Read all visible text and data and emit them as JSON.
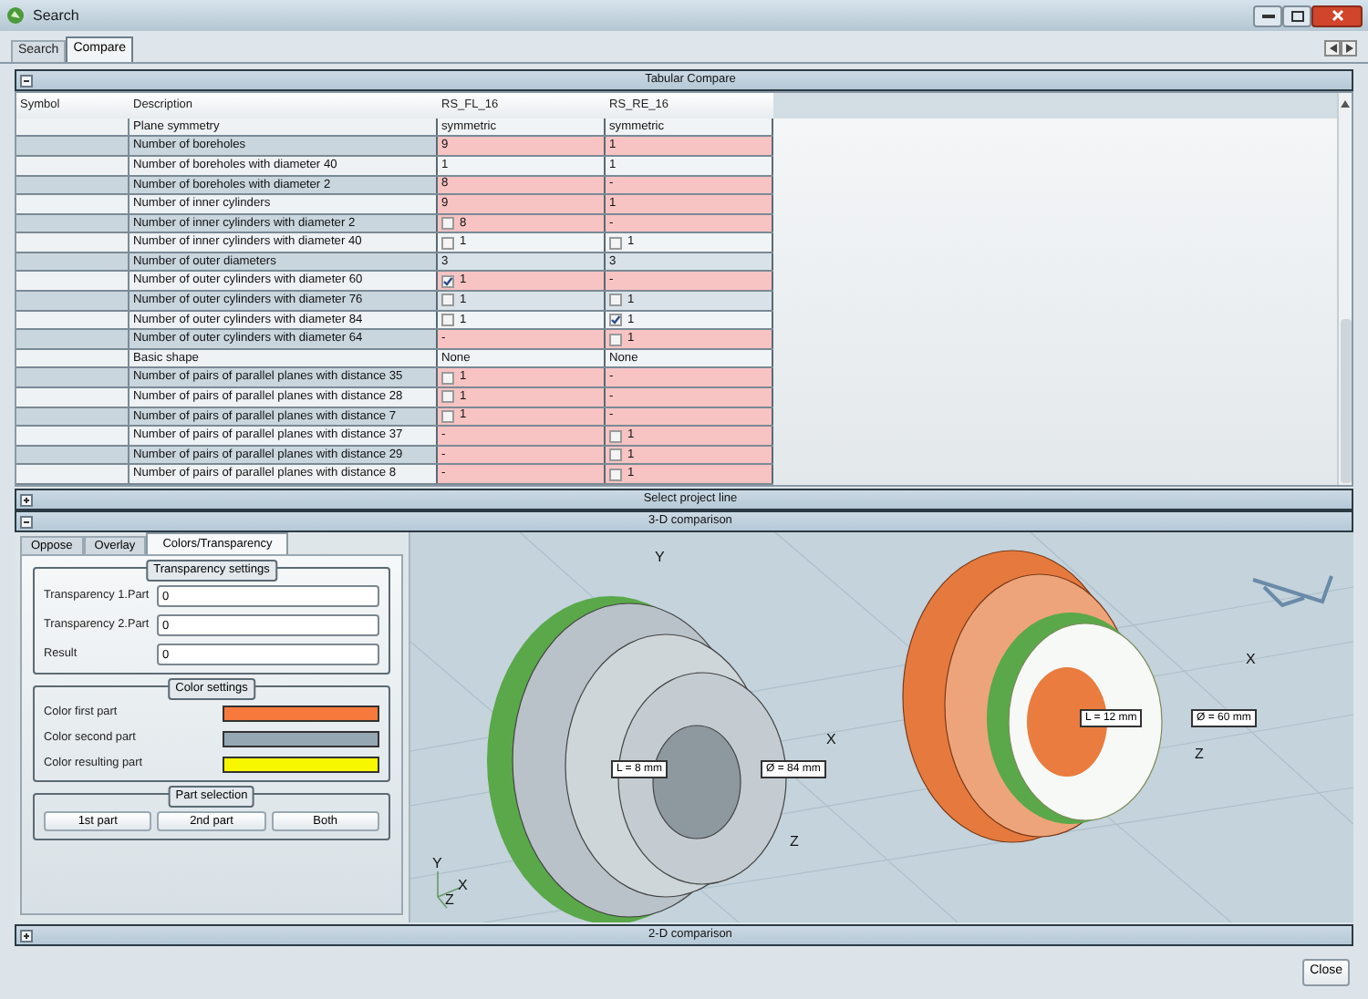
{
  "window": {
    "title": "Search"
  },
  "tabs": [
    {
      "label": "Search",
      "selected": false
    },
    {
      "label": "Compare",
      "selected": true
    }
  ],
  "tabular_compare": {
    "title": "Tabular Compare",
    "expanded": true
  },
  "table": {
    "columns": [
      "Symbol",
      "Description",
      "RS_FL_16",
      "RS_RE_16"
    ],
    "rows": [
      {
        "description": "Plane symmetry",
        "differs": false,
        "values": [
          {
            "kind": "text",
            "text": "symmetric"
          },
          {
            "kind": "text",
            "text": "symmetric"
          }
        ]
      },
      {
        "description": "Number of boreholes",
        "differs": true,
        "values": [
          {
            "kind": "text",
            "text": "9"
          },
          {
            "kind": "text",
            "text": "1"
          }
        ]
      },
      {
        "description": "Number of boreholes with diameter 40",
        "differs": false,
        "values": [
          {
            "kind": "text",
            "text": "1"
          },
          {
            "kind": "text",
            "text": "1"
          }
        ]
      },
      {
        "description": "Number of boreholes with diameter 2",
        "differs": true,
        "values": [
          {
            "kind": "text",
            "text": "8"
          },
          {
            "kind": "text",
            "text": "-"
          }
        ]
      },
      {
        "description": "Number of inner cylinders",
        "differs": true,
        "values": [
          {
            "kind": "text",
            "text": "9"
          },
          {
            "kind": "text",
            "text": "1"
          }
        ]
      },
      {
        "description": "Number of inner cylinders with diameter 2",
        "differs": true,
        "values": [
          {
            "kind": "check",
            "checked": false,
            "text": "8"
          },
          {
            "kind": "text",
            "text": "-"
          }
        ]
      },
      {
        "description": "Number of inner cylinders with diameter 40",
        "differs": false,
        "values": [
          {
            "kind": "check",
            "checked": false,
            "text": "1"
          },
          {
            "kind": "check",
            "checked": false,
            "text": "1"
          }
        ]
      },
      {
        "description": "Number of outer diameters",
        "differs": false,
        "values": [
          {
            "kind": "text",
            "text": "3"
          },
          {
            "kind": "text",
            "text": "3"
          }
        ]
      },
      {
        "description": "Number of outer cylinders with diameter 60",
        "differs": true,
        "values": [
          {
            "kind": "check",
            "checked": true,
            "text": "1"
          },
          {
            "kind": "text",
            "text": "-"
          }
        ]
      },
      {
        "description": "Number of outer cylinders with diameter 76",
        "differs": false,
        "values": [
          {
            "kind": "check",
            "checked": false,
            "text": "1"
          },
          {
            "kind": "check",
            "checked": false,
            "text": "1"
          }
        ]
      },
      {
        "description": "Number of outer cylinders with diameter 84",
        "differs": false,
        "values": [
          {
            "kind": "check",
            "checked": false,
            "text": "1"
          },
          {
            "kind": "check",
            "checked": true,
            "text": "1"
          }
        ]
      },
      {
        "description": "Number of outer cylinders with diameter 64",
        "differs": true,
        "values": [
          {
            "kind": "text",
            "text": "-"
          },
          {
            "kind": "check",
            "checked": false,
            "text": "1"
          }
        ]
      },
      {
        "description": "Basic shape",
        "differs": false,
        "values": [
          {
            "kind": "text",
            "text": "None"
          },
          {
            "kind": "text",
            "text": "None"
          }
        ]
      },
      {
        "description": "Number of pairs of parallel planes with distance 35",
        "differs": true,
        "values": [
          {
            "kind": "check",
            "checked": false,
            "text": "1"
          },
          {
            "kind": "text",
            "text": "-"
          }
        ]
      },
      {
        "description": "Number of pairs of parallel planes with distance 28",
        "differs": true,
        "values": [
          {
            "kind": "check",
            "checked": false,
            "text": "1"
          },
          {
            "kind": "text",
            "text": "-"
          }
        ]
      },
      {
        "description": "Number of pairs of parallel planes with distance 7",
        "differs": true,
        "values": [
          {
            "kind": "check",
            "checked": false,
            "text": "1"
          },
          {
            "kind": "text",
            "text": "-"
          }
        ]
      },
      {
        "description": "Number of pairs of parallel planes with distance 37",
        "differs": true,
        "values": [
          {
            "kind": "text",
            "text": "-"
          },
          {
            "kind": "check",
            "checked": false,
            "text": "1"
          }
        ]
      },
      {
        "description": "Number of pairs of parallel planes with distance 29",
        "differs": true,
        "values": [
          {
            "kind": "text",
            "text": "-"
          },
          {
            "kind": "check",
            "checked": false,
            "text": "1"
          }
        ]
      },
      {
        "description": "Number of pairs of parallel planes with distance 8",
        "differs": true,
        "values": [
          {
            "kind": "text",
            "text": "-"
          },
          {
            "kind": "check",
            "checked": false,
            "text": "1"
          }
        ]
      }
    ]
  },
  "select_project_line": {
    "title": "Select project line",
    "expanded": false
  },
  "comparison_3d": {
    "title": "3-D comparison",
    "expanded": true
  },
  "sub_tabs": [
    {
      "label": "Oppose",
      "selected": false
    },
    {
      "label": "Overlay",
      "selected": false
    },
    {
      "label": "Colors/Transparency",
      "selected": true
    }
  ],
  "transparency_settings": {
    "title": "Transparency settings",
    "fields": [
      {
        "label": "Transparency 1.Part",
        "value": "0"
      },
      {
        "label": "Transparency 2.Part",
        "value": "0"
      },
      {
        "label": "Result",
        "value": "0"
      }
    ]
  },
  "color_settings": {
    "title": "Color settings",
    "items": [
      {
        "label": "Color first part",
        "color": "#f57a3c"
      },
      {
        "label": "Color second part",
        "color": "#95a7b3"
      },
      {
        "label": "Color resulting part",
        "color": "#f7f700"
      }
    ]
  },
  "part_selection": {
    "title": "Part selection",
    "buttons": [
      "1st part",
      "2nd part",
      "Both"
    ]
  },
  "viewport": {
    "labels": [
      {
        "kind": "axis",
        "text": "Y"
      },
      {
        "kind": "axis",
        "text": "X"
      },
      {
        "kind": "axis",
        "text": "Z"
      },
      {
        "kind": "dimension",
        "text": "L = 8 mm"
      },
      {
        "kind": "dimension",
        "text": "Ø = 84 mm"
      },
      {
        "kind": "dimension",
        "text": "L = 12 mm"
      },
      {
        "kind": "dimension",
        "text": "Ø = 60 mm"
      },
      {
        "kind": "axis",
        "text": "X"
      },
      {
        "kind": "axis",
        "text": "Z"
      },
      {
        "kind": "axis",
        "text": "Y"
      },
      {
        "kind": "axis",
        "text": "X"
      },
      {
        "kind": "axis",
        "text": "Z"
      }
    ]
  },
  "comparison_2d": {
    "title": "2-D comparison",
    "expanded": false
  },
  "close_button": "Close"
}
